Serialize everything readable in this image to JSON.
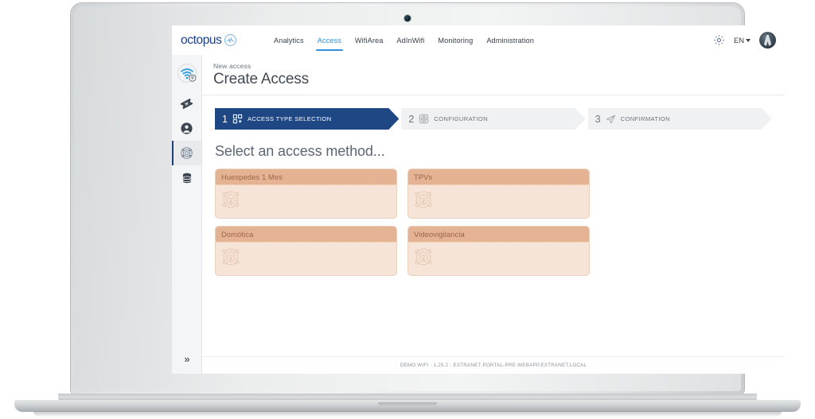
{
  "brand": {
    "name": "octopus",
    "mark_icon": "wave-logo-icon"
  },
  "topnav": {
    "items": [
      {
        "label": "Analytics",
        "active": false
      },
      {
        "label": "Access",
        "active": true
      },
      {
        "label": "WifiArea",
        "active": false
      },
      {
        "label": "AdInWifi",
        "active": false
      },
      {
        "label": "Monitoring",
        "active": false
      },
      {
        "label": "Administration",
        "active": false
      }
    ],
    "settings_icon": "gear-icon",
    "language": "EN",
    "language_chevron_icon": "chevron-down-icon",
    "avatar_icon": "user-avatar"
  },
  "sidebar": {
    "logo_icon": "wifi-location-icon",
    "items": [
      {
        "icon": "ticket-icon",
        "name": "vouchers",
        "active": false
      },
      {
        "icon": "user-icon",
        "name": "users",
        "active": false
      },
      {
        "icon": "access-target-icon",
        "name": "access",
        "active": true
      },
      {
        "icon": "database-icon",
        "name": "database",
        "active": false
      }
    ],
    "expand_label": "»"
  },
  "header": {
    "subtitle": "New access",
    "title": "Create Access"
  },
  "stepper": {
    "steps": [
      {
        "num": "1",
        "label": "ACCESS TYPE SELECTION",
        "icon": "grid-plus-icon",
        "active": true
      },
      {
        "num": "2",
        "label": "CONFIGURATION",
        "icon": "target-icon",
        "active": false
      },
      {
        "num": "3",
        "label": "CONFIRMATION",
        "icon": "paper-plane-icon",
        "active": false
      }
    ]
  },
  "main": {
    "heading": "Select an access method...",
    "cards": [
      {
        "title": "Huespedes 1 Mes",
        "icon": "hotspot-icon"
      },
      {
        "title": "TPVs",
        "icon": "hotspot-icon"
      },
      {
        "title": "Domótica",
        "icon": "hotspot-icon"
      },
      {
        "title": "Videovigilancia",
        "icon": "hotspot-icon"
      }
    ]
  },
  "footer": {
    "text": "DEMO WIFI · 1.25.2 · EXTRANET-PORTAL-PRE-WEBAPP.EXTRANET.LOCAL"
  },
  "colors": {
    "brand_blue": "#1b3f86",
    "accent_blue": "#2f8fd8",
    "step_active": "#1e4784",
    "card_header": "#e3b394",
    "card_body": "#f5e4d7",
    "card_text": "#9d6547"
  }
}
